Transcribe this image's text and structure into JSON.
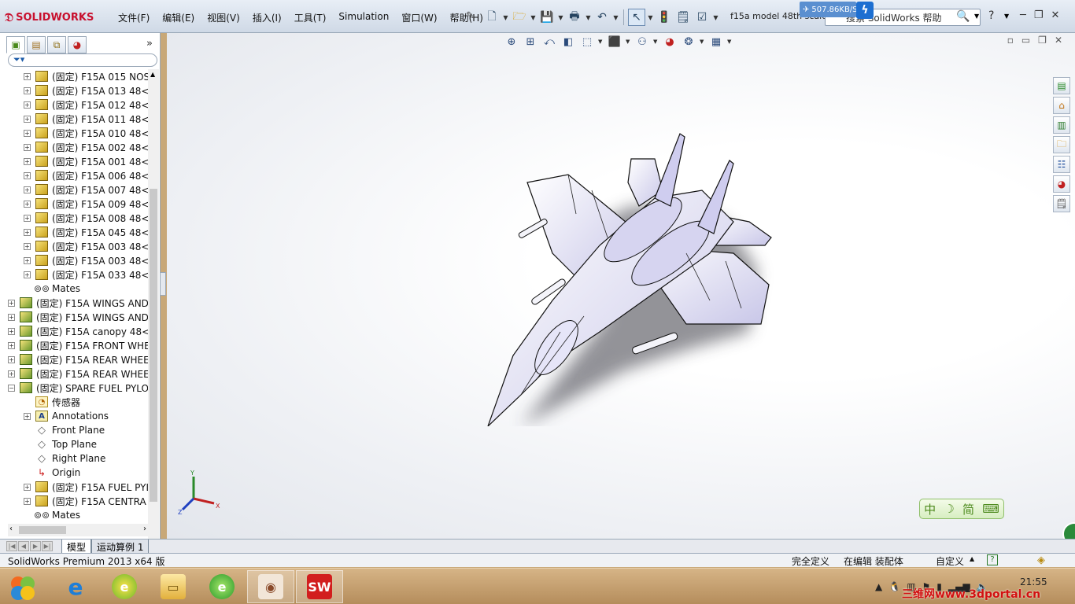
{
  "app": {
    "logo_text": "SOLIDWORKS",
    "doc_title": "f15a model 48th scale",
    "speed_badge": "507.86KB/S"
  },
  "menu": [
    "文件(F)",
    "编辑(E)",
    "视图(V)",
    "插入(I)",
    "工具(T)",
    "Simulation",
    "窗口(W)",
    "帮助(H)"
  ],
  "search": {
    "placeholder": "搜索 SolidWorks 帮助"
  },
  "panel": {
    "tabs": [
      "featuremanager",
      "propertymanager",
      "configurationmanager",
      "displaymanager"
    ],
    "tree": [
      {
        "indent": 1,
        "exp": "+",
        "icon": "part",
        "label": "(固定) F15A 015 NOS"
      },
      {
        "indent": 1,
        "exp": "+",
        "icon": "part",
        "label": "(固定) F15A 013 48<"
      },
      {
        "indent": 1,
        "exp": "+",
        "icon": "part",
        "label": "(固定) F15A 012 48<"
      },
      {
        "indent": 1,
        "exp": "+",
        "icon": "part",
        "label": "(固定) F15A 011 48<"
      },
      {
        "indent": 1,
        "exp": "+",
        "icon": "part",
        "label": "(固定) F15A 010 48<"
      },
      {
        "indent": 1,
        "exp": "+",
        "icon": "part",
        "label": "(固定) F15A 002 48<"
      },
      {
        "indent": 1,
        "exp": "+",
        "icon": "part",
        "label": "(固定) F15A 001 48<"
      },
      {
        "indent": 1,
        "exp": "+",
        "icon": "part",
        "label": "(固定) F15A 006 48<"
      },
      {
        "indent": 1,
        "exp": "+",
        "icon": "part",
        "label": "(固定) F15A 007 48<"
      },
      {
        "indent": 1,
        "exp": "+",
        "icon": "part",
        "label": "(固定) F15A 009 48<"
      },
      {
        "indent": 1,
        "exp": "+",
        "icon": "part",
        "label": "(固定) F15A 008 48<"
      },
      {
        "indent": 1,
        "exp": "+",
        "icon": "part",
        "label": "(固定) F15A 045 48<"
      },
      {
        "indent": 1,
        "exp": "+",
        "icon": "part",
        "label": "(固定) F15A 003 48<"
      },
      {
        "indent": 1,
        "exp": "+",
        "icon": "part",
        "label": "(固定) F15A 003 48<"
      },
      {
        "indent": 1,
        "exp": "+",
        "icon": "part",
        "label": "(固定) F15A 033 48<"
      },
      {
        "indent": 1,
        "exp": "",
        "icon": "mates",
        "label": "Mates"
      },
      {
        "indent": 0,
        "exp": "+",
        "icon": "asm",
        "label": "(固定) F15A WINGS AND"
      },
      {
        "indent": 0,
        "exp": "+",
        "icon": "asm",
        "label": "(固定) F15A WINGS AND"
      },
      {
        "indent": 0,
        "exp": "+",
        "icon": "asm",
        "label": "(固定) F15A canopy 48<"
      },
      {
        "indent": 0,
        "exp": "+",
        "icon": "asm",
        "label": "(固定) F15A FRONT WHE"
      },
      {
        "indent": 0,
        "exp": "+",
        "icon": "asm",
        "label": "(固定) F15A REAR WHEE"
      },
      {
        "indent": 0,
        "exp": "+",
        "icon": "asm",
        "label": "(固定) F15A REAR WHEE"
      },
      {
        "indent": 0,
        "exp": "-",
        "icon": "asm",
        "label": "(固定) SPARE FUEL PYLO"
      },
      {
        "indent": 1,
        "exp": "",
        "icon": "sensor",
        "label": "传感器"
      },
      {
        "indent": 1,
        "exp": "+",
        "icon": "ann",
        "label": "Annotations"
      },
      {
        "indent": 1,
        "exp": "",
        "icon": "plane",
        "label": "Front Plane"
      },
      {
        "indent": 1,
        "exp": "",
        "icon": "plane",
        "label": "Top Plane"
      },
      {
        "indent": 1,
        "exp": "",
        "icon": "plane",
        "label": "Right Plane"
      },
      {
        "indent": 1,
        "exp": "",
        "icon": "origin",
        "label": "Origin"
      },
      {
        "indent": 1,
        "exp": "+",
        "icon": "part",
        "label": "(固定) F15A FUEL PYL"
      },
      {
        "indent": 1,
        "exp": "+",
        "icon": "part",
        "label": "(固定) F15A  CENTRA"
      },
      {
        "indent": 1,
        "exp": "",
        "icon": "mates",
        "label": "Mates"
      }
    ]
  },
  "bottom_tabs": [
    "模型",
    "运动算例 1"
  ],
  "ime": {
    "lang": "中",
    "mode": "简"
  },
  "status": {
    "app_version": "SolidWorks Premium 2013 x64 版",
    "definition": "完全定义",
    "editing": "在编辑 装配体",
    "units": "自定义"
  },
  "triad": {
    "x": "X",
    "y": "Y",
    "z": "Z"
  },
  "taskbar": {
    "clock": "21:55",
    "watermark": "三维网www.3dportal.cn",
    "apps": [
      "browser-ie",
      "browser-360",
      "file-explorer",
      "browser-360-green",
      "image-viewer",
      "solidworks"
    ]
  },
  "colors": {
    "accent": "#c8102e",
    "taskbar": "#c8a878",
    "model_fill": "#ecebf7"
  }
}
